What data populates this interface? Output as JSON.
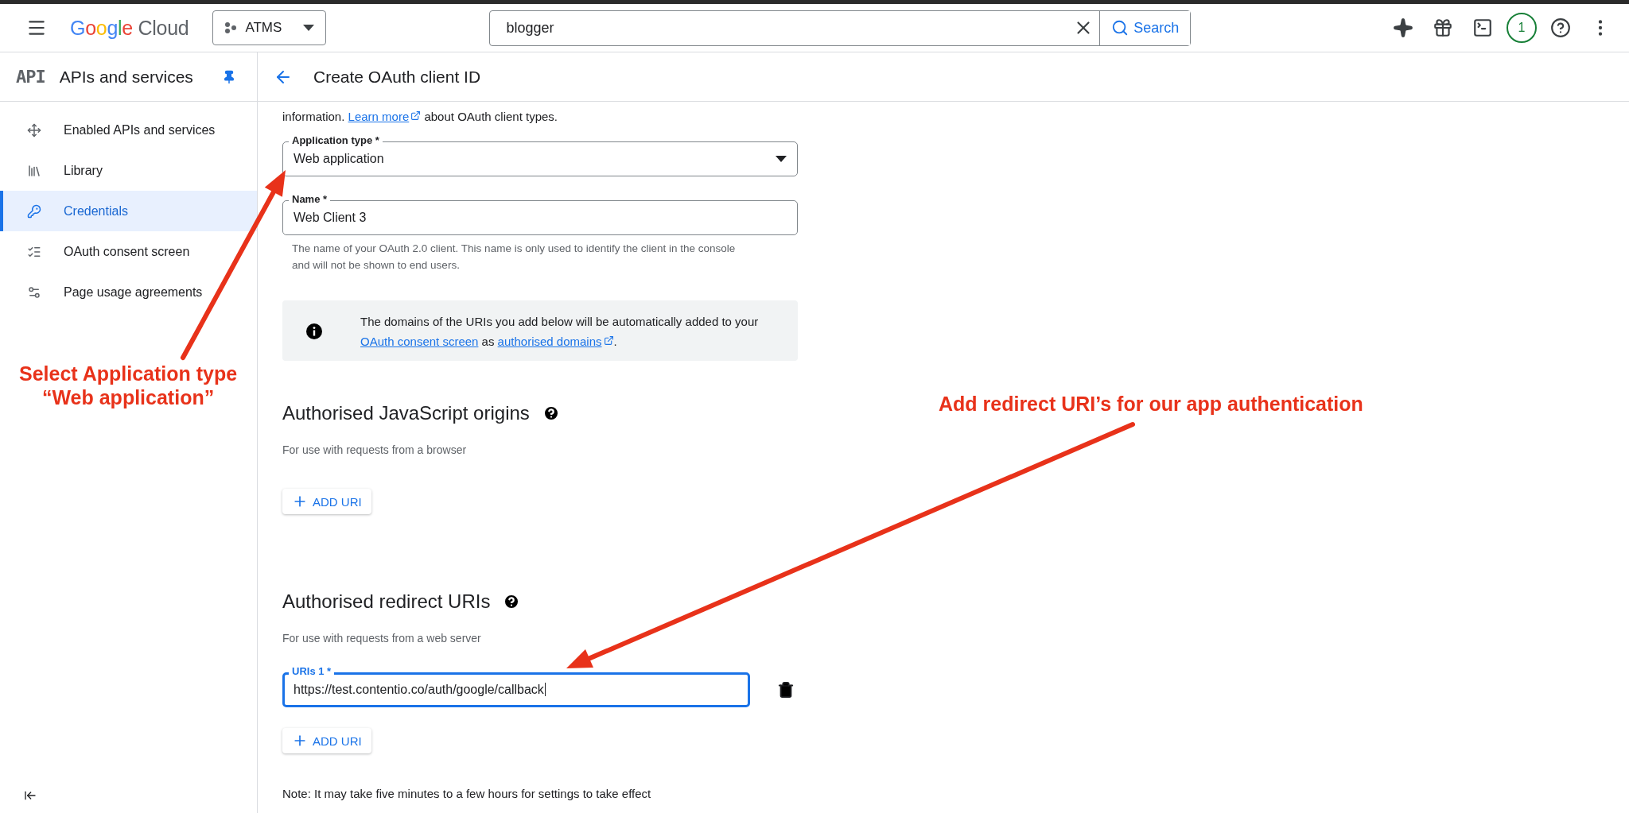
{
  "topbar": {
    "logo": "Google Cloud",
    "project": "ATMS",
    "search": {
      "value": "blogger",
      "button": "Search"
    },
    "notifications": "1"
  },
  "sidebar": {
    "badge": "API",
    "title": "APIs and services",
    "items": [
      {
        "label": "Enabled APIs and services",
        "selected": false
      },
      {
        "label": "Library",
        "selected": false
      },
      {
        "label": "Credentials",
        "selected": true
      },
      {
        "label": "OAuth consent screen",
        "selected": false
      },
      {
        "label": "Page usage agreements",
        "selected": false
      }
    ]
  },
  "page": {
    "title": "Create OAuth client ID",
    "intro": {
      "before": "information.",
      "link": "Learn more",
      "after": "about OAuth client types."
    },
    "application_type": {
      "label": "Application type *",
      "value": "Web application"
    },
    "name": {
      "label": "Name *",
      "value": "Web Client 3",
      "helper": "The name of your OAuth 2.0 client. This name is only used to identify the client in the console and will not be shown to end users."
    },
    "notice": {
      "before": "The domains of the URIs you add below will be automatically added to your",
      "link1": "OAuth consent screen",
      "middle": "as",
      "link2": "authorised domains",
      "end": "."
    },
    "sections": [
      {
        "title": "Authorised JavaScript origins",
        "subtitle": "For use with requests from a browser",
        "button": "ADD URI"
      },
      {
        "title": "Authorised redirect URIs",
        "subtitle": "For use with requests from a web server",
        "uris": [
          {
            "label": "URIs 1 *",
            "value": "https://test.contentio.co/auth/google/callback",
            "focused": true
          }
        ],
        "button": "ADD URI"
      }
    ],
    "note": "Note: It may take five minutes to a few hours for settings to take effect"
  },
  "annotations": [
    {
      "lines": [
        "Select Application type",
        "“Web application”"
      ]
    },
    {
      "lines": [
        "Add redirect URI’s for our app authentication"
      ]
    }
  ]
}
